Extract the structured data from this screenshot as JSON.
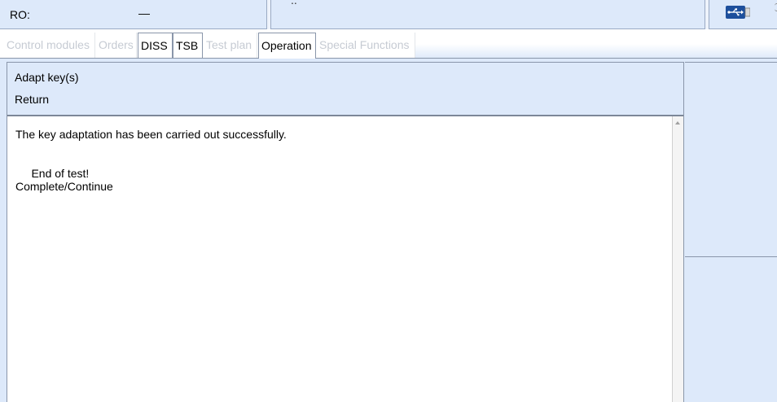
{
  "header": {
    "ro_label": "RO:",
    "ro_value": "—",
    "mid_fragment": "..",
    "usb_icon": "usb-icon"
  },
  "tabs": [
    {
      "label": "Control modules",
      "state": "disabled"
    },
    {
      "label": "Orders",
      "state": "disabled"
    },
    {
      "label": "DISS",
      "state": "enabled"
    },
    {
      "label": "TSB",
      "state": "enabled"
    },
    {
      "label": "Test plan",
      "state": "disabled"
    },
    {
      "label": "Operation",
      "state": "active"
    },
    {
      "label": "Special Functions",
      "state": "disabled"
    }
  ],
  "menu": {
    "adapt_keys": "Adapt key(s)",
    "return": "Return"
  },
  "content": {
    "text": "The key adaptation has been carried out successfully.\n\n\n     End of test!\nComplete/Continue"
  },
  "colors": {
    "panel_bg": "#dde9fa",
    "border": "#8a96aa",
    "disabled_text": "#c6cbd3"
  }
}
